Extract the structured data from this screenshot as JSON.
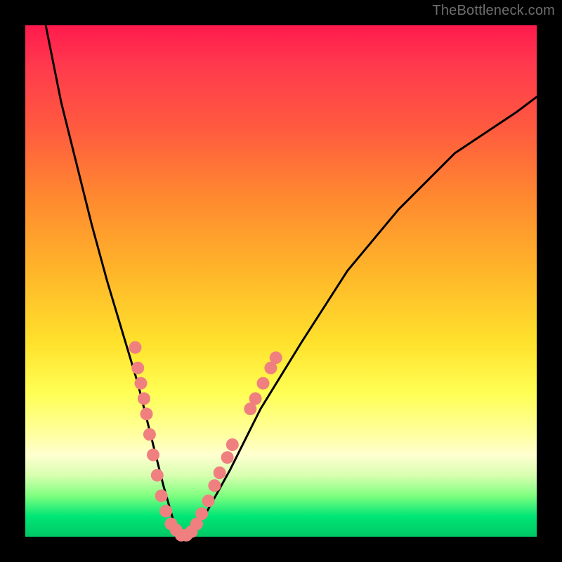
{
  "watermark": {
    "text": "TheBottleneck.com"
  },
  "chart_data": {
    "type": "line",
    "title": "",
    "xlabel": "",
    "ylabel": "",
    "xlim": [
      0,
      100
    ],
    "ylim": [
      0,
      100
    ],
    "grid": false,
    "legend": false,
    "series": [
      {
        "name": "bottleneck-curve",
        "x": [
          4,
          7,
          10,
          13,
          16,
          19,
          22,
          25,
          27,
          29,
          31,
          35,
          40,
          46,
          54,
          63,
          73,
          84,
          96,
          100
        ],
        "y": [
          100,
          85,
          73,
          61,
          50,
          40,
          30,
          18,
          10,
          3,
          0,
          4,
          13,
          25,
          38,
          52,
          64,
          75,
          83,
          86
        ]
      }
    ],
    "highlight_points": {
      "name": "scatter-highlights",
      "color": "#f08080",
      "points": [
        {
          "x": 21.5,
          "y": 37
        },
        {
          "x": 22.0,
          "y": 33
        },
        {
          "x": 22.6,
          "y": 30
        },
        {
          "x": 23.2,
          "y": 27
        },
        {
          "x": 23.7,
          "y": 24
        },
        {
          "x": 24.3,
          "y": 20
        },
        {
          "x": 25.0,
          "y": 16
        },
        {
          "x": 25.8,
          "y": 12
        },
        {
          "x": 26.6,
          "y": 8
        },
        {
          "x": 27.5,
          "y": 5
        },
        {
          "x": 28.5,
          "y": 2.5
        },
        {
          "x": 29.5,
          "y": 1.3
        },
        {
          "x": 30.5,
          "y": 0.3
        },
        {
          "x": 31.5,
          "y": 0.3
        },
        {
          "x": 32.5,
          "y": 1
        },
        {
          "x": 33.5,
          "y": 2.5
        },
        {
          "x": 34.5,
          "y": 4.5
        },
        {
          "x": 35.8,
          "y": 7
        },
        {
          "x": 37.0,
          "y": 10
        },
        {
          "x": 38.0,
          "y": 12.5
        },
        {
          "x": 39.5,
          "y": 15.5
        },
        {
          "x": 40.5,
          "y": 18
        },
        {
          "x": 44.0,
          "y": 25
        },
        {
          "x": 45.0,
          "y": 27
        },
        {
          "x": 46.5,
          "y": 30
        },
        {
          "x": 48.0,
          "y": 33
        },
        {
          "x": 49.0,
          "y": 35
        }
      ]
    }
  }
}
